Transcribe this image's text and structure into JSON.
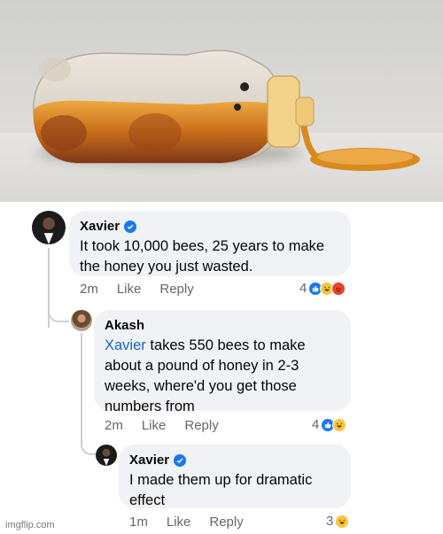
{
  "comments": [
    {
      "author": "Xavier",
      "text": "It took 10,000 bees, 25 years to make the honey you just wasted.",
      "time": "2m",
      "like_label": "Like",
      "reply_label": "Reply",
      "reaction_count": "4",
      "reactions": [
        "like-icon",
        "haha-icon",
        "angry-icon"
      ]
    },
    {
      "author": "Akash",
      "mention": "Xavier",
      "text": " takes 550 bees to make about a pound of honey in 2-3 weeks, where'd you get those numbers from",
      "time": "2m",
      "like_label": "Like",
      "reply_label": "Reply",
      "reaction_count": "4",
      "reactions": [
        "like-icon",
        "haha-icon"
      ]
    },
    {
      "author": "Xavier",
      "text": "I made them up for dramatic effect",
      "time": "1m",
      "like_label": "Like",
      "reply_label": "Reply",
      "reaction_count": "3",
      "reactions": [
        "haha-icon"
      ]
    }
  ],
  "watermark": "imgflip.com",
  "colors": {
    "verified": "#1877f2",
    "mention": "#1a64c8",
    "bubble": "#f0f2f5",
    "honey": "#d98a1c"
  }
}
